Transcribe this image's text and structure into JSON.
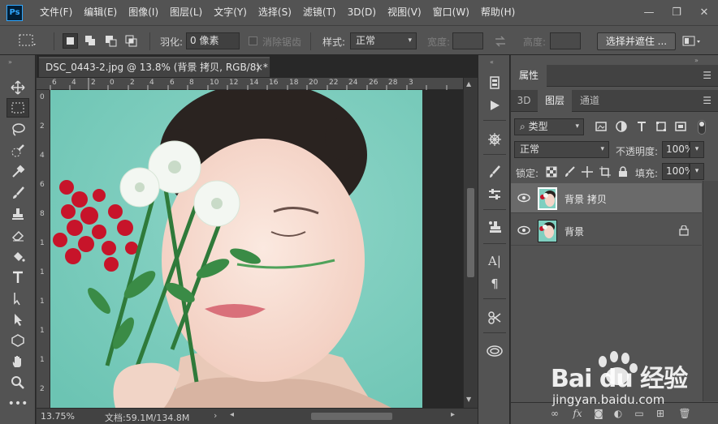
{
  "app": {
    "logo": "Ps"
  },
  "menu": [
    "文件(F)",
    "编辑(E)",
    "图像(I)",
    "图层(L)",
    "文字(Y)",
    "选择(S)",
    "滤镜(T)",
    "3D(D)",
    "视图(V)",
    "窗口(W)",
    "帮助(H)"
  ],
  "window_controls": {
    "minimize": "—",
    "restore": "❐",
    "close": "✕"
  },
  "options": {
    "feather_label": "羽化:",
    "feather_value": "0 像素",
    "antialias_label": "消除锯齿",
    "style_label": "样式:",
    "style_value": "正常",
    "width_label": "宽度:",
    "height_label": "高度:",
    "select_mask_button": "选择并遮住 ..."
  },
  "document": {
    "tab_title": "DSC_0443-2.jpg @ 13.8% (背景 拷贝, RGB/8) *",
    "close": "×",
    "zoom": "13.75%",
    "doc_info": "文档:59.1M/134.8M",
    "ruler_top_labels": [
      "6",
      "4",
      "2",
      "0",
      "2",
      "4",
      "6",
      "8",
      "10",
      "12",
      "14",
      "16",
      "18",
      "20",
      "22",
      "24",
      "26",
      "28",
      "3"
    ],
    "ruler_left_labels": [
      "0",
      "2",
      "4",
      "6",
      "8",
      "1",
      "1",
      "1",
      "1",
      "1",
      "2"
    ]
  },
  "properties_panel": {
    "tab": "属性"
  },
  "layers_panel": {
    "tabs": [
      "3D",
      "图层",
      "通道"
    ],
    "active_tab": "图层",
    "filter_kind": "类型",
    "blend_mode": "正常",
    "opacity_label": "不透明度:",
    "opacity_value": "100%",
    "lock_label": "锁定:",
    "fill_label": "填充:",
    "fill_value": "100%",
    "layers": [
      {
        "name": "背景 拷贝",
        "selected": true,
        "locked": false
      },
      {
        "name": "背景",
        "selected": false,
        "locked": true
      }
    ]
  },
  "watermark": {
    "brand": "Bai du 经验",
    "url": "jingyan.baidu.com"
  }
}
